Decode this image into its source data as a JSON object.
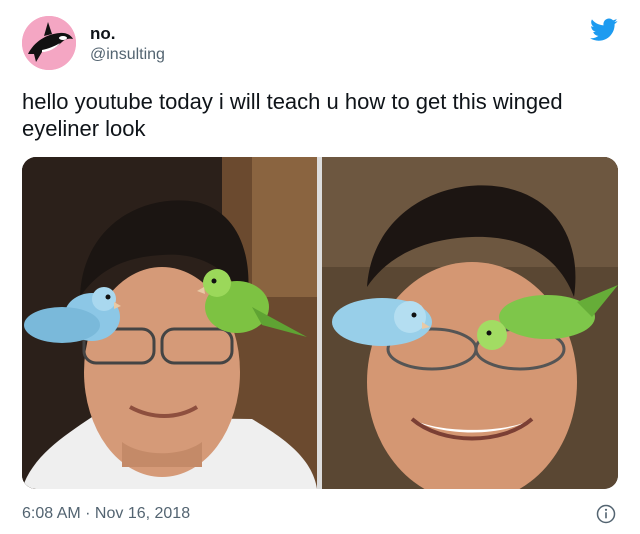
{
  "tweet": {
    "display_name": "no.",
    "handle": "@insulting",
    "text": "hello youtube today i will teach u how to get this winged eyeliner look",
    "timestamp": "6:08 AM · Nov 16, 2018"
  },
  "icons": {
    "brand": "twitter-bird-icon",
    "info": "info-icon"
  },
  "colors": {
    "brand_blue": "#1d9bf0",
    "avatar_bg": "#f4a6c3",
    "secondary_text": "#536471"
  }
}
